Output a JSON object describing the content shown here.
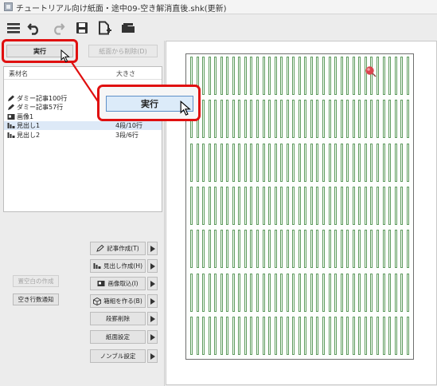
{
  "window": {
    "title": "チュートリアル向け紙面・途中09-空き解消直後.shk(更新)"
  },
  "toolbar": {
    "icons": [
      "menu-icon",
      "undo-icon",
      "redo-icon",
      "save-icon",
      "new-document-icon",
      "open-folder-icon"
    ]
  },
  "buttons": {
    "run": "実行",
    "remove_from_paper": "紙面から削除(D)",
    "run_enlarged": "実行"
  },
  "material_list": {
    "columns": {
      "name": "素材名",
      "size": "大きさ"
    },
    "rows": [
      {
        "icon": "pencil-icon",
        "name": "ダミー記事100行",
        "size": ""
      },
      {
        "icon": "pencil-icon",
        "name": "ダミー記事57行",
        "size": ""
      },
      {
        "icon": "image-icon",
        "name": "画像1",
        "size": ""
      },
      {
        "icon": "headline-icon",
        "name": "見出し1",
        "size": "4段/10行",
        "selected": true
      },
      {
        "icon": "headline-icon",
        "name": "見出し2",
        "size": "3段/6行"
      }
    ]
  },
  "actions": [
    {
      "icon": "pencil-icon",
      "label": "記事作成(T)"
    },
    {
      "icon": "headline-icon",
      "label": "見出し作成(H)"
    },
    {
      "icon": "image-icon",
      "label": "画像取込(I)"
    },
    {
      "icon": "box-icon",
      "label": "箱組を作る(B)"
    },
    {
      "icon": "",
      "label": "段罫削除"
    },
    {
      "icon": "",
      "label": "紙面設定"
    },
    {
      "icon": "",
      "label": "ノンブル設定"
    }
  ],
  "side_buttons": {
    "check_blank": "置空白の作成",
    "notify_blank_lines": "空き行数通知"
  },
  "paper": {
    "tiers": 7,
    "columns_per_tier": 37
  },
  "colors": {
    "highlight": "#e01010",
    "grid_line": "#5e9a5e",
    "selection": "#dde9f7"
  }
}
